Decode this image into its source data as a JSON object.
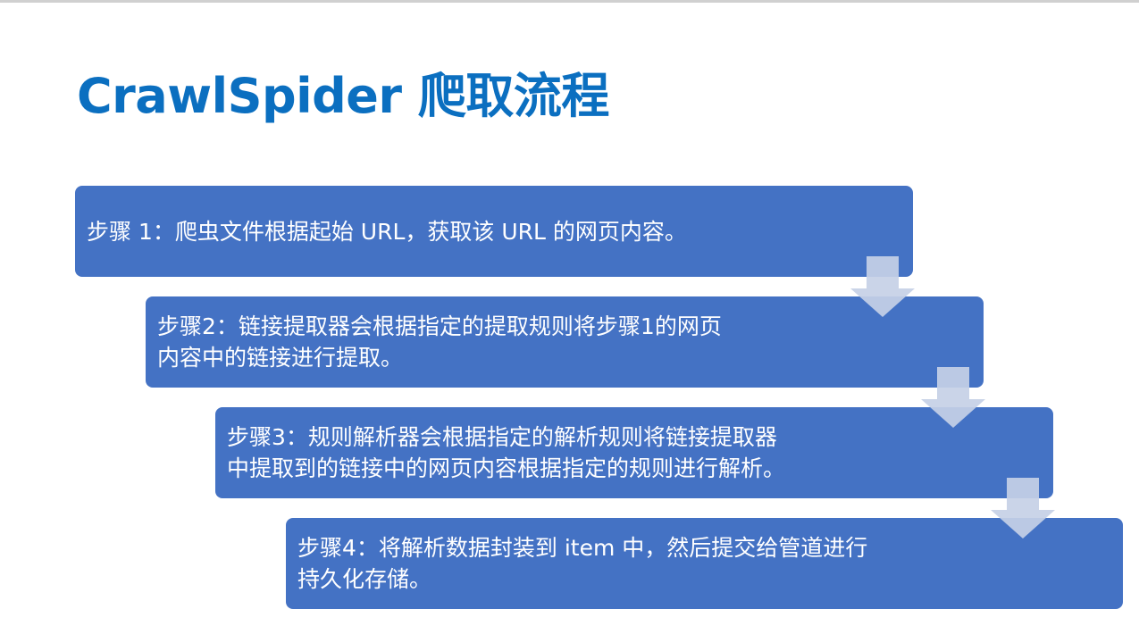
{
  "title": "CrawlSpider 爬取流程",
  "steps": [
    {
      "lines": [
        "步骤 1：爬虫文件根据起始 URL，获取该 URL 的网页内容。"
      ]
    },
    {
      "lines": [
        "步骤2：链接提取器会根据指定的提取规则将步骤1的网页",
        "内容中的链接进行提取。"
      ]
    },
    {
      "lines": [
        "步骤3：规则解析器会根据指定的解析规则将链接提取器",
        "中提取到的链接中的网页内容根据指定的规则进行解析。"
      ]
    },
    {
      "lines": [
        "步骤4：将解析数据封装到 item 中，然后提交给管道进行",
        "持久化存储。"
      ]
    }
  ],
  "colors": {
    "title": "#0b6fc0",
    "box": "#4472c4",
    "arrow": "#c5d0e6",
    "text": "#ffffff"
  },
  "icons": [
    "down-arrow-icon"
  ]
}
